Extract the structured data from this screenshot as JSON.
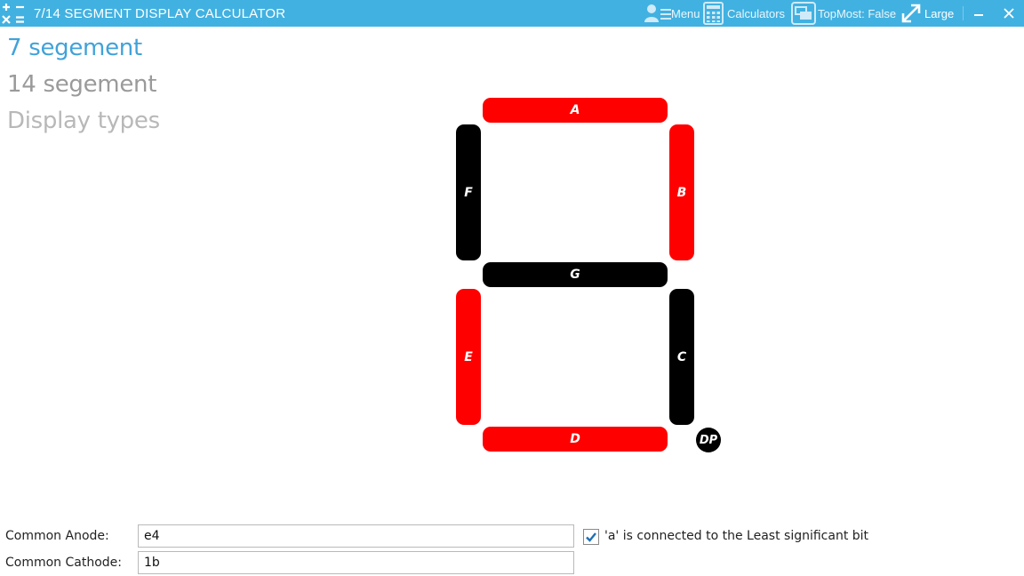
{
  "window": {
    "title": "7/14 SEGMENT DISPLAY CALCULATOR",
    "toolbar": {
      "menu_label": "Menu",
      "calculators_label": "Calculators",
      "topmost_label": "TopMost: False",
      "size_label": "Large"
    }
  },
  "nav": {
    "items": [
      {
        "label": "7 segement",
        "state": "selected"
      },
      {
        "label": "14 segement",
        "state": "normal"
      },
      {
        "label": "Display types",
        "state": "normal"
      }
    ]
  },
  "display": {
    "on_color": "#ff0000",
    "off_color": "#000000",
    "segments": {
      "a": {
        "label": "A",
        "on": true
      },
      "b": {
        "label": "B",
        "on": true
      },
      "c": {
        "label": "C",
        "on": false
      },
      "d": {
        "label": "D",
        "on": true
      },
      "e": {
        "label": "E",
        "on": true
      },
      "f": {
        "label": "F",
        "on": false
      },
      "g": {
        "label": "G",
        "on": false
      },
      "dp": {
        "label": "DP",
        "on": false
      }
    }
  },
  "form": {
    "common_anode_label": "Common Anode:",
    "common_anode_value": "e4",
    "common_cathode_label": "Common Cathode:",
    "common_cathode_value": "1b",
    "lsb_checkbox_label": "'a' is connected to the Least significant bit",
    "lsb_checked": true
  },
  "colors": {
    "titlebar": "#41b1e1",
    "accent": "#41a2d9"
  }
}
